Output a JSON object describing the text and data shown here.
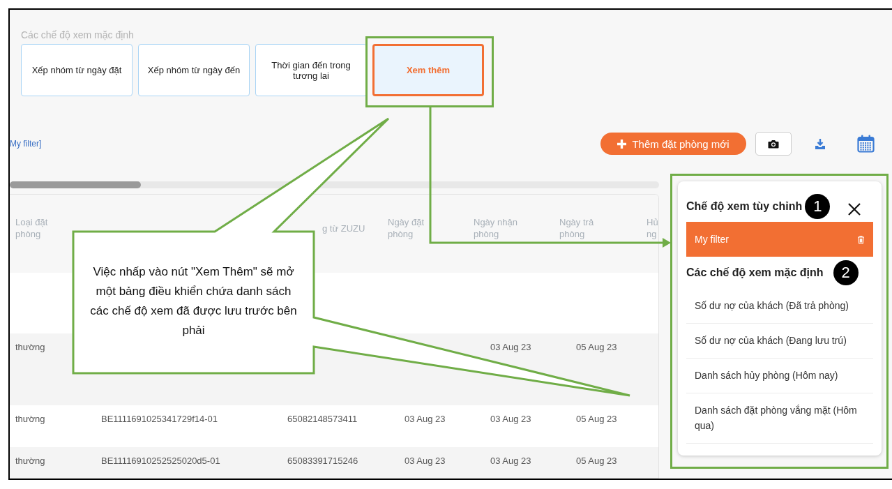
{
  "default_views": {
    "label": "Các chế độ xem mặc định",
    "cards": [
      {
        "label": "Xếp nhóm từ ngày đặt",
        "selected": false
      },
      {
        "label": "Xếp nhóm từ ngày đến",
        "selected": false
      },
      {
        "label": "Thời gian đến trong tương lai",
        "selected": false
      },
      {
        "label": "Xem thêm",
        "selected": true
      }
    ]
  },
  "filter_link": "My filter]",
  "toolbar": {
    "add_button": "Thêm đặt phòng mới"
  },
  "table": {
    "columns": [
      "Loại đặt phòng",
      null,
      "g từ ZUZU",
      "Ngày đặt phòng",
      "Ngày nhận phòng",
      "Ngày trả phòng",
      "Hủ ng"
    ],
    "rows": [
      [
        "thường",
        null,
        null,
        null,
        "03 Aug 23",
        "05 Aug 23"
      ],
      [
        "thường",
        "BE1111691025341729f14-01",
        "65082148573411",
        "03 Aug 23",
        "03 Aug 23",
        "05 Aug 23"
      ],
      [
        "thường",
        "BE11116910252525020d5-01",
        "65083391715246",
        "03 Aug 23",
        "03 Aug 23",
        "05 Aug 23"
      ]
    ]
  },
  "panel": {
    "custom_title": "Chế độ xem tùy chỉnh",
    "custom_items": [
      {
        "label": "My filter",
        "selected": true
      }
    ],
    "default_title": "Các chế độ xem mặc định",
    "default_items": [
      {
        "label": "Số dư nợ của khách (Đã trả phòng)",
        "selected": false
      },
      {
        "label": "Số dư nợ của khách (Đang lưu trú)",
        "selected": false
      },
      {
        "label": "Danh sách hủy phòng (Hôm nay)",
        "selected": false
      },
      {
        "label": "Danh sách đặt phòng vắng mặt (Hôm qua)",
        "selected": false
      }
    ]
  },
  "annotations": {
    "badges": [
      "1",
      "2"
    ],
    "callout": "Việc nhấp vào nút \"Xem Thêm\" sẽ mở một bảng điều khiển chứa danh sách các chế độ xem đã được lưu trước bên phải"
  }
}
